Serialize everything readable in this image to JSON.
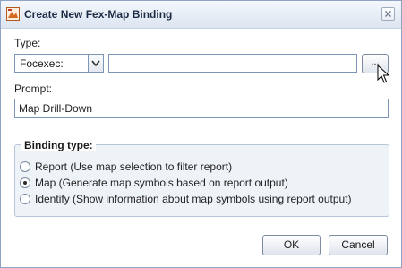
{
  "window": {
    "title": "Create New Fex-Map Binding",
    "app_icon": "map-icon",
    "close_icon": "close-icon"
  },
  "type_section": {
    "label": "Type:",
    "select_value": "Focexec:",
    "select_arrow_icon": "chevron-down-icon",
    "path_value": "",
    "browse_label": "..."
  },
  "prompt_section": {
    "label": "Prompt:",
    "value": "Map Drill-Down"
  },
  "binding_type": {
    "legend": "Binding type:",
    "options": [
      {
        "label": "Report (Use map selection to filter report)",
        "selected": false
      },
      {
        "label": "Map (Generate map symbols based on report output)",
        "selected": true
      },
      {
        "label": "Identify (Show information about map symbols using report output)",
        "selected": false
      }
    ]
  },
  "buttons": {
    "ok": "OK",
    "cancel": "Cancel"
  }
}
